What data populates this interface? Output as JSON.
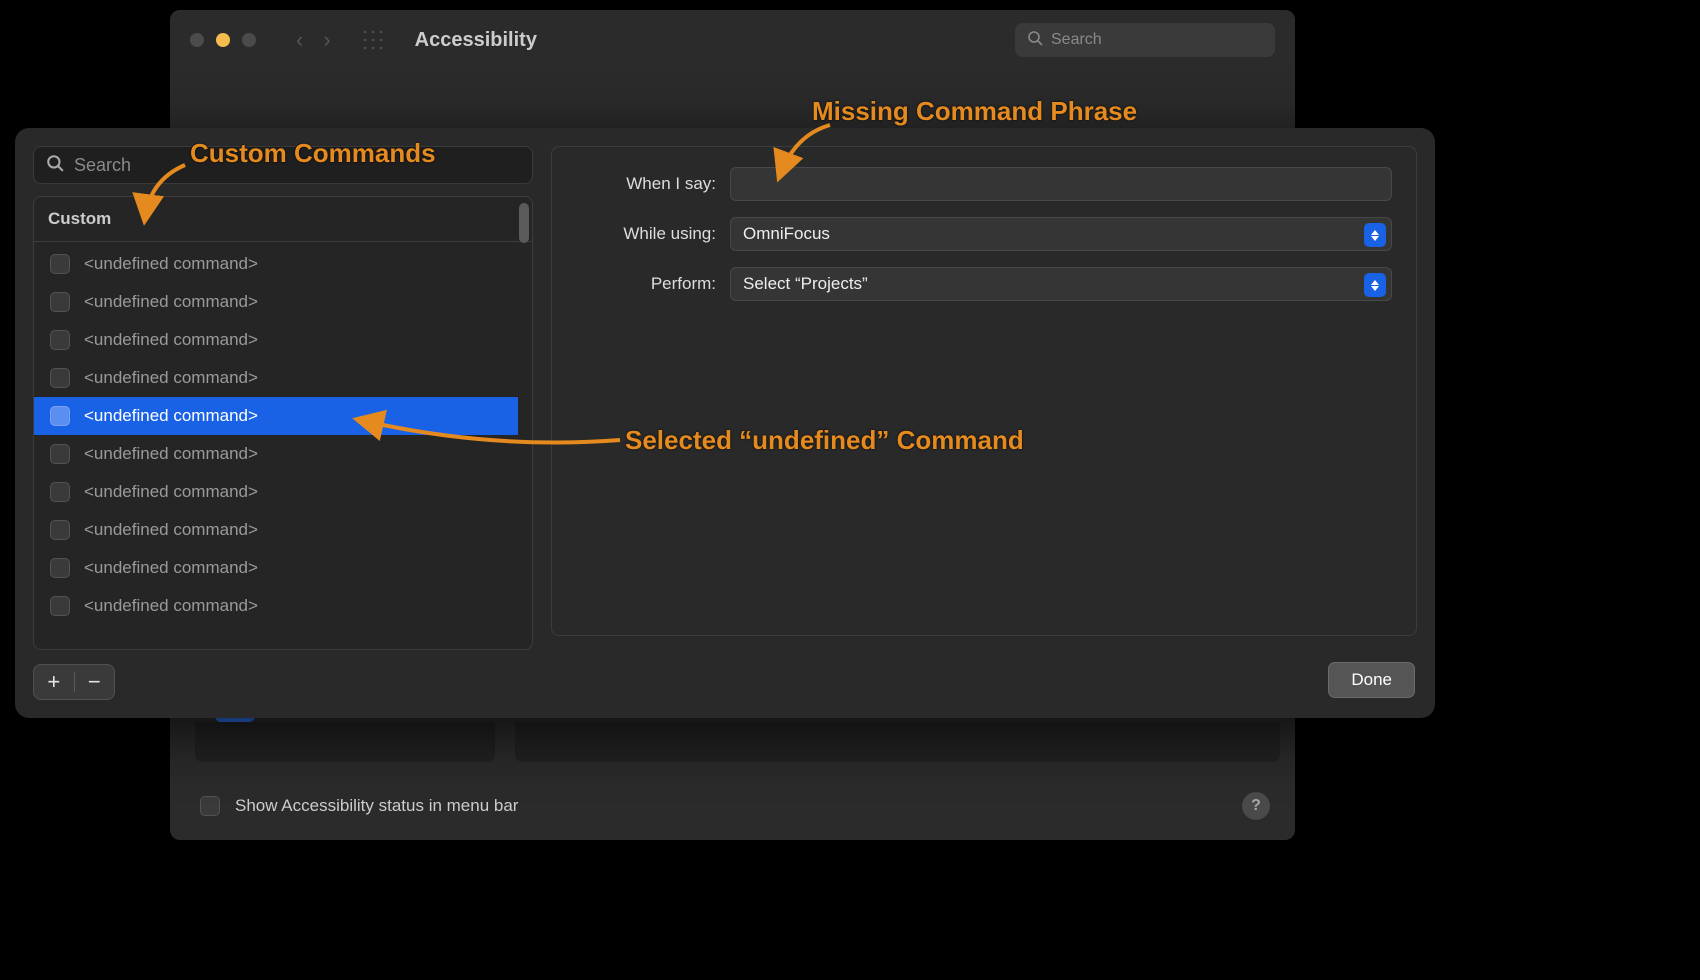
{
  "back_window": {
    "title": "Accessibility",
    "search_placeholder": "Search",
    "status_checkbox_label": "Show Accessibility status in menu bar"
  },
  "sheet": {
    "search_placeholder": "Search",
    "list_header": "Custom",
    "commands": [
      {
        "label": "<undefined command>",
        "selected": false
      },
      {
        "label": "<undefined command>",
        "selected": false
      },
      {
        "label": "<undefined command>",
        "selected": false
      },
      {
        "label": "<undefined command>",
        "selected": false
      },
      {
        "label": "<undefined command>",
        "selected": true
      },
      {
        "label": "<undefined command>",
        "selected": false
      },
      {
        "label": "<undefined command>",
        "selected": false
      },
      {
        "label": "<undefined command>",
        "selected": false
      },
      {
        "label": "<undefined command>",
        "selected": false
      },
      {
        "label": "<undefined command>",
        "selected": false
      }
    ],
    "form": {
      "when_i_say_label": "When I say:",
      "when_i_say_value": "",
      "while_using_label": "While using:",
      "while_using_value": "OmniFocus",
      "perform_label": "Perform:",
      "perform_value": "Select “Projects”"
    },
    "done_label": "Done"
  },
  "annotations": {
    "custom_commands": "Custom Commands",
    "missing_phrase": "Missing Command Phrase",
    "selected_undefined": "Selected “undefined” Command"
  }
}
